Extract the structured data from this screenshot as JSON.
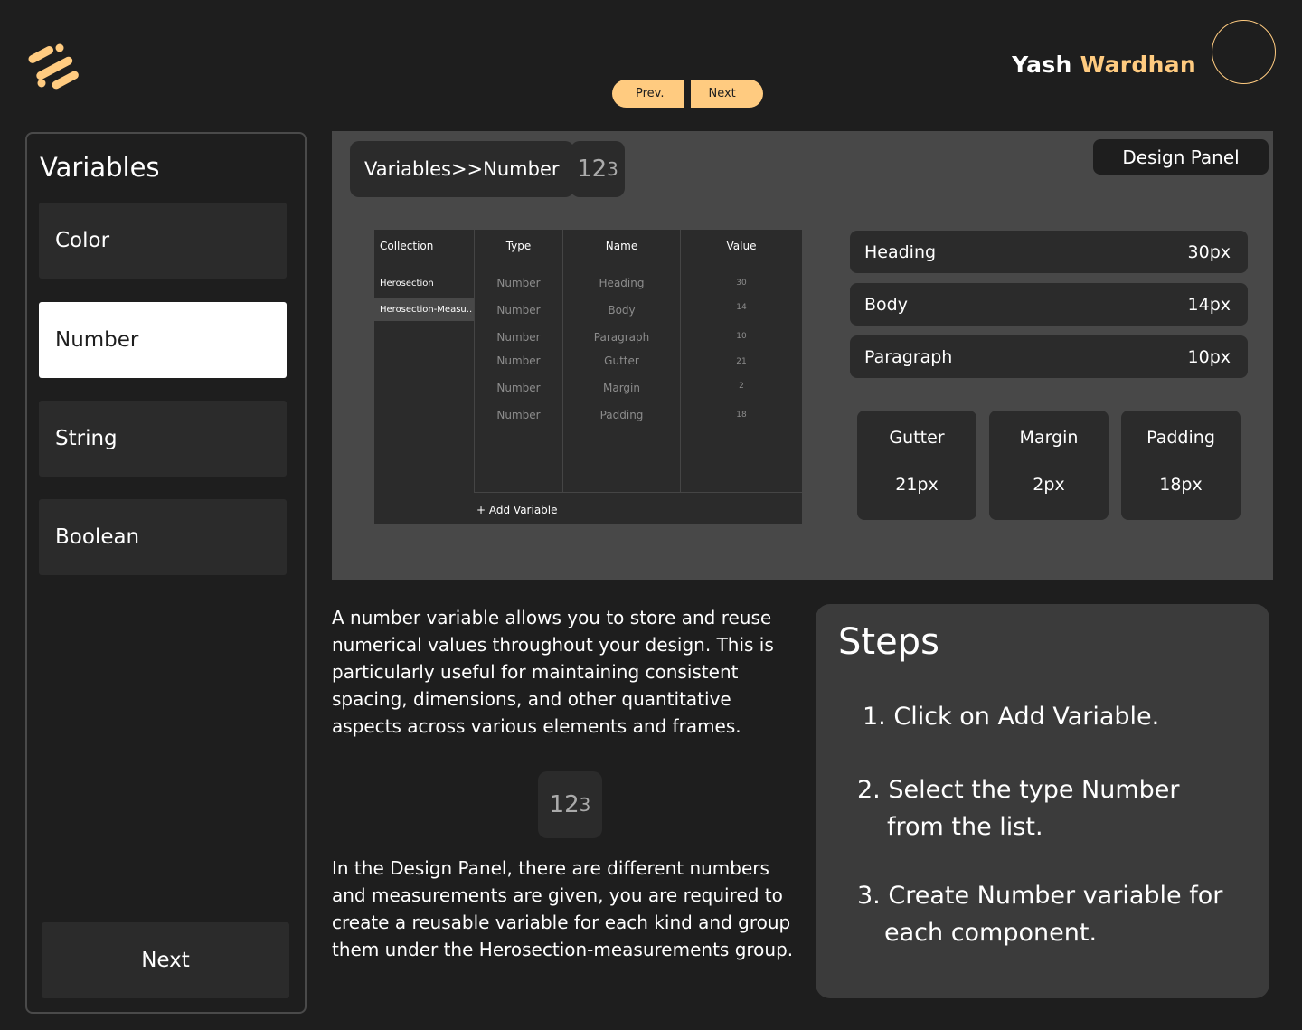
{
  "header": {
    "prev_label": "Prev.",
    "next_label": "Next",
    "user_first": "Yash",
    "user_last": "Wardhan"
  },
  "sidebar": {
    "title": "Variables",
    "items": [
      {
        "label": "Color",
        "active": false
      },
      {
        "label": "Number",
        "active": true
      },
      {
        "label": "String",
        "active": false
      },
      {
        "label": "Boolean",
        "active": false
      }
    ],
    "next_label": "Next"
  },
  "panel": {
    "breadcrumb": "Variables>>Number",
    "icon_text_main": "12",
    "icon_text_small": "3",
    "design_label": "Design Panel",
    "table": {
      "headers": [
        "Collection",
        "Type",
        "Name",
        "Value"
      ],
      "collections": [
        "Herosection",
        "Herosection-Measu.."
      ],
      "rows": [
        {
          "type": "Number",
          "name": "Heading",
          "value": "30"
        },
        {
          "type": "Number",
          "name": "Body",
          "value": "14"
        },
        {
          "type": "Number",
          "name": "Paragraph",
          "value": "10"
        },
        {
          "type": "Number",
          "name": "Gutter",
          "value": "21"
        },
        {
          "type": "Number",
          "name": "Margin",
          "value": "2"
        },
        {
          "type": "Number",
          "name": "Padding",
          "value": "18"
        }
      ],
      "add_label": "+ Add Variable"
    },
    "rows": [
      {
        "label": "Heading",
        "value": "30px"
      },
      {
        "label": "Body",
        "value": "14px"
      },
      {
        "label": "Paragraph",
        "value": "10px"
      }
    ],
    "boxes": [
      {
        "label": "Gutter",
        "value": "21px"
      },
      {
        "label": "Margin",
        "value": "2px"
      },
      {
        "label": "Padding",
        "value": "18px"
      }
    ]
  },
  "content": {
    "desc1": "A number variable allows you to store and reuse numerical values throughout your design. This is particularly useful for maintaining consistent spacing, dimensions, and other quantitative aspects across various elements and frames.",
    "desc2": "In the Design Panel, there are different numbers and measurements are given, you are required to create a reusable variable for each kind and group them under the Herosection-measurements group."
  },
  "steps": {
    "title": "Steps",
    "items": [
      {
        "num": "1.",
        "text": "Click on Add Variable."
      },
      {
        "num": "2.",
        "text": "Select the type Number from the list."
      },
      {
        "num": "3.",
        "text": "Create Number variable for each component."
      }
    ]
  },
  "colors": {
    "accent": "#ffcb80",
    "background": "#1e1e1e",
    "panel": "#484848",
    "card": "#2b2b2b"
  }
}
